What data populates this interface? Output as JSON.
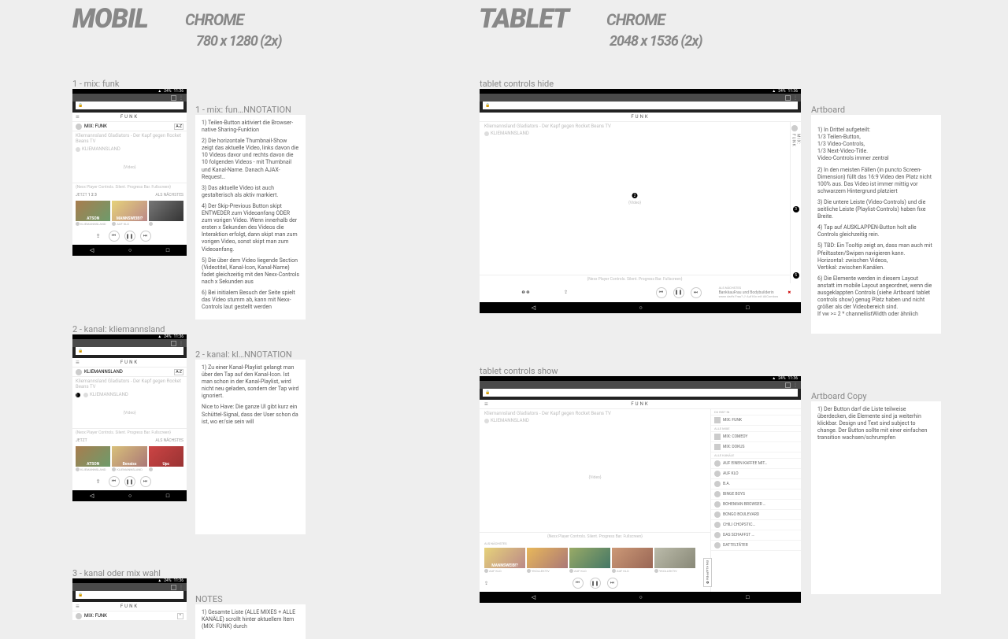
{
  "headings": {
    "mobil": "MOBIL",
    "chrome": "CHROME",
    "mobil_dim": "780 x 1280 (2x)",
    "tablet": "TABLET",
    "tablet_dim": "2048 x 1536 (2x)"
  },
  "status": {
    "battery": "24%",
    "time": "11:36"
  },
  "brand": "FUNK",
  "mixlabel": "MIX: FUNK",
  "kanallabel": "KLIEMANNSLAND",
  "az": "A-Z",
  "video_title": "Kliemannsland Gladiators - Der Kapf gegen Rocket Beans TV",
  "channel_name": "KLIEMANNSLAND",
  "video_placeholder": "{Video}",
  "controls_note": "{Nexx Player Controls. Silent. Progress Bar. Fullscreen}",
  "jetzt": "JETZT",
  "counts": "1 2 3",
  "als_nachstes": "ALS NÄCHSTES",
  "thumbs": [
    {
      "t": "ATSON",
      "sub": "KLIEMANNSLAND"
    },
    {
      "t": "MANNSWEIB!?",
      "sub": "AUF KLO"
    },
    {
      "t": "",
      "sub": ""
    }
  ],
  "thumbs2": [
    {
      "t": "ATSON",
      "sub": "KLIEMANNSLAND"
    },
    {
      "t": "Benaiss",
      "sub": "KLIEMANNSLAND"
    },
    {
      "t": "Upc",
      "sub": ""
    }
  ],
  "artboards": {
    "m1": "1 - mix: funk",
    "m1a": "1 - mix: fun…NNOTATION",
    "m2": "2 - kanal: kliemannsland",
    "m2a": "2 - kanal: kl…NNOTATION",
    "m3": "3 - kanal oder mix wahl",
    "notes": "NOTES",
    "t1": "tablet controls hide",
    "t1a": "Artboard",
    "t2": "tablet controls show",
    "t2a": "Artboard Copy"
  },
  "anno1": [
    "1) Teilen-Button aktiviert die Browser-native Sharing-Funktion",
    "2) Die horizontale Thumbnail-Show zeigt das aktuelle Video, links davon die 10 Videos davor und rechts davon die 10 folgenden Videos - mit Thumbnail und Kanal-Name. Danach AJAX-Request…",
    "3) Das aktuelle Video ist auch gestalterisch als aktiv markiert.",
    "4) Der Skip-Previous Button skipt ENTWEDER zum Videoanfang ODER zum vorigen Video. Wenn innerhalb der ersten x Sekunden des Videos die Interaktion erfolgt, dann skipt man zum vorigen Video, sonst skipt man zum Videoanfang.",
    "5) Die über dem Video liegende Section (Videotitel, Kanal-Icon, Kanal-Name) fadet gleichzeitig mit den Nexx-Controls nach x Sekunden aus",
    "6) Bei initialem Besuch der Seite spielt das Video stumm ab, kann mit Nexx-Controls laut gestellt werden"
  ],
  "anno2": [
    "1) Zu einer Kanal-Playlist gelangt man über den Tap auf den Kanal-Icon. Ist man schon in der Kanal-Playlist, wird nicht neu geladen, sondern der Tap wird ignoriert.",
    "Nice to Have: Die ganze UI gibt kurz ein Schüttel-Signal, dass der User schon da ist, wo er/sie sein will"
  ],
  "anno_notes": [
    "1) Gesamte Liste (ALLE MIXES + ALLE KANÄLE) scrollt hinter aktuellem Item (MIX: FUNK) durch"
  ],
  "anno_tablet": [
    "1) In Drittel aufgeteilt:\n1/3 Teilen-Button,\n1/3 Video-Controls,\n1/3 Next-Video-Title.\nVideo-Controls immer zentral",
    "2) In den meisten Fällen (in puncto Screen-Dimension) füllt das 16:9 Video den Platz nicht 100% aus. Das Video ist immer mittig vor schwarzem Hintergrund platziert",
    "3) Die untere Leiste (Video-Controls) und die seitliche Leiste (Playlist-Controls) haben fixe Breite.",
    "4) Tap auf AUSKLAPPEN-Button holt alle Controls gleichzeitig rein.",
    "5) TBD: Ein Tooltip zeigt an, dass man auch mit Pfeiltasten/Swipen navigieren kann.\nHorizontal: zwischen Videos,\nVertikal: zwischen Kanälen.",
    "6) Die Elemente werden in diesem Layout anstatt im mobile Layout angeordnet, wenn die ausgeklappten Controls (siehe Artboard tablet controls show) genug Platz haben und nicht größer als der Videobereich sind.\nIf vw >= 2 * channellistWidth oder ähnlich"
  ],
  "anno_tablet2": [
    "1) Der Button darf die Liste teilweise überdecken, die Elemente sind ja weiterhin klickbar. Design und Text sind subject to change. Der Button sollte mit einer einfachen transition wachsen/schrumpfen"
  ],
  "tablet_next": {
    "label": "ALS NÄCHSTES",
    "title": "BankkauFrau und Bodybuilderin",
    "sub": "wann darfs Frau? // Auf Klo mit AliCombos"
  },
  "panel": {
    "best": "DU BIST IN",
    "mixes_label": "ALLE MIXE",
    "mixes": [
      "MIX: FUNK",
      "MIX: COMEDY",
      "MIX: DOKUS"
    ],
    "kanale_label": "ALLE KANÄLE",
    "kanale": [
      "AUF EINEN KAFFEE MIT…",
      "AUF KLO",
      "B.A.",
      "BINGE BOYS",
      "BOHEMIAN BROWSER …",
      "BONGO BOULEVARD",
      "CHILI CHOPSTIC…",
      "DAS SCHAFFST …",
      "DATTELTÄTER"
    ]
  },
  "einklappen": "EIN KLAPPEN",
  "tablet_thumbs": [
    {
      "t": "MANNSWEIB!?",
      "sub": "AUF KLO"
    },
    {
      "t": "",
      "sub": "YKOLLEKTIV"
    },
    {
      "t": "",
      "sub": "AUF KLO"
    },
    {
      "t": "",
      "sub": "AUF KLO"
    },
    {
      "t": "",
      "sub": "YKOLLEKTIV"
    }
  ]
}
